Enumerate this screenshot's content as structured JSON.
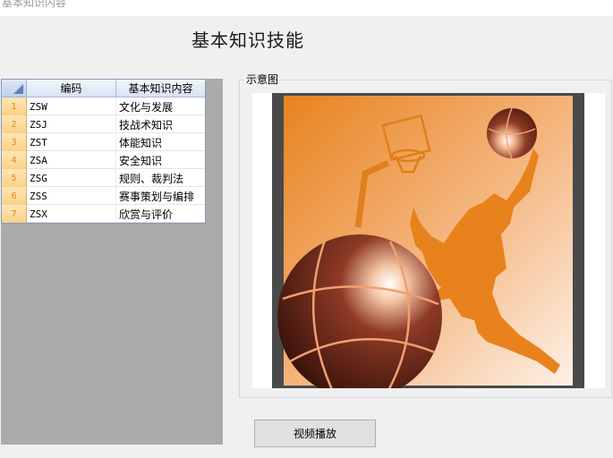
{
  "window": {
    "title": "基本知识内容"
  },
  "page": {
    "title": "基本知识技能"
  },
  "grid": {
    "columns": [
      "编码",
      "基本知识内容"
    ],
    "rows": [
      {
        "num": "1",
        "code": "ZSW",
        "name": "文化与发展"
      },
      {
        "num": "2",
        "code": "ZSJ",
        "name": "技战术知识"
      },
      {
        "num": "3",
        "code": "ZST",
        "name": "体能知识"
      },
      {
        "num": "4",
        "code": "ZSA",
        "name": "安全知识"
      },
      {
        "num": "5",
        "code": "ZSG",
        "name": "规则、裁判法"
      },
      {
        "num": "6",
        "code": "ZSS",
        "name": "赛事策划与编排"
      },
      {
        "num": "7",
        "code": "ZSX",
        "name": "欣赏与评价"
      }
    ]
  },
  "preview": {
    "label": "示意图",
    "image": "basketball-dunk-silhouette"
  },
  "buttons": {
    "video_play": "视频播放"
  },
  "colors": {
    "accent_orange": "#e8831f",
    "basketball": "#5a1e12",
    "row_header": "#fcd088",
    "grid_border": "#8a9bb3"
  }
}
